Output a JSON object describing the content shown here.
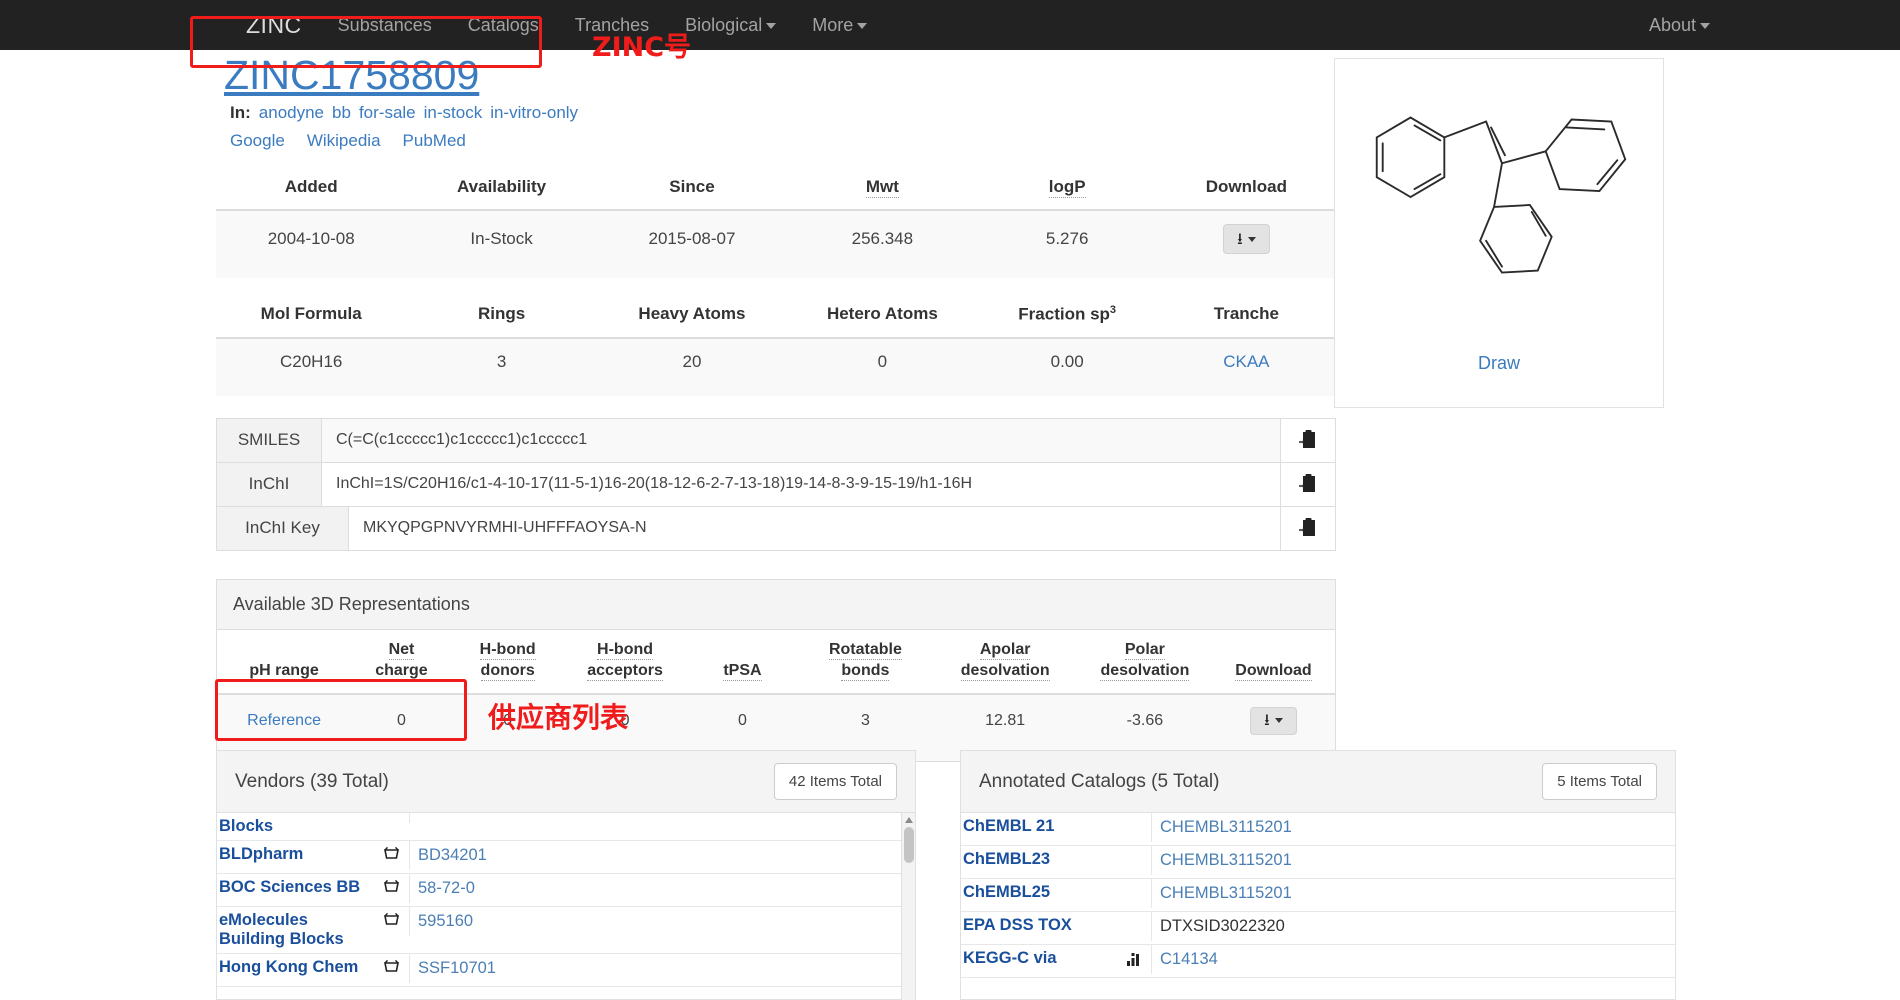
{
  "navbar": {
    "brand": "ZINC",
    "items": [
      {
        "label": "Substances",
        "caret": false
      },
      {
        "label": "Catalogs",
        "caret": false
      },
      {
        "label": "Tranches",
        "caret": false
      },
      {
        "label": "Biological",
        "caret": true
      },
      {
        "label": "More",
        "caret": true
      }
    ],
    "right": {
      "label": "About",
      "caret": true
    }
  },
  "annotations": {
    "zinc_id_note": "ZINC号",
    "vendors_note": "供应商列表",
    "color": "#f01c1c"
  },
  "header": {
    "zinc_id": "ZINC1758809",
    "in_label": "In:",
    "in_tags": [
      "anodyne",
      "bb",
      "for-sale",
      "in-stock",
      "in-vitro-only"
    ],
    "external_links": [
      "Google",
      "Wikipedia",
      "PubMed"
    ]
  },
  "summary_table": {
    "headers": [
      "Added",
      "Availability",
      "Since",
      "Mwt",
      "logP",
      "Download"
    ],
    "dotted_headers": [
      "Mwt",
      "logP"
    ],
    "row": {
      "added": "2004-10-08",
      "availability": "In-Stock",
      "since": "2015-08-07",
      "mwt": "256.348",
      "logp": "5.276",
      "download_icon": "download-icon"
    }
  },
  "formula_table": {
    "headers": [
      "Mol Formula",
      "Rings",
      "Heavy Atoms",
      "Hetero Atoms",
      "Fraction sp",
      "Tranche"
    ],
    "fraction_sup": "3",
    "row": {
      "mol_formula": "C20H16",
      "rings": "3",
      "heavy_atoms": "20",
      "hetero_atoms": "0",
      "fraction_sp3": "0.00",
      "tranche": "CKAA"
    }
  },
  "identifiers": [
    {
      "label": "SMILES",
      "value": "C(=C(c1ccccc1)c1ccccc1)c1ccccc1",
      "copy_icon": "clipboard-icon"
    },
    {
      "label": "InChI",
      "value": "InChI=1S/C20H16/c1-4-10-17(11-5-1)16-20(18-12-6-2-7-13-18)19-14-8-3-9-15-19/h1-16H",
      "copy_icon": "clipboard-icon"
    },
    {
      "label": "InChI Key",
      "value": "MKYQPGPNVYRMHI-UHFFFAOYSA-N",
      "copy_icon": "clipboard-icon"
    }
  ],
  "representations_3d": {
    "title": "Available 3D Representations",
    "headers": [
      {
        "line1": "pH range",
        "line2": ""
      },
      {
        "line1": "Net",
        "line2": "charge"
      },
      {
        "line1": "H-bond",
        "line2": "donors"
      },
      {
        "line1": "H-bond",
        "line2": "acceptors"
      },
      {
        "line1": "tPSA",
        "line2": ""
      },
      {
        "line1": "Rotatable",
        "line2": "bonds"
      },
      {
        "line1": "Apolar",
        "line2": "desolvation"
      },
      {
        "line1": "Polar",
        "line2": "desolvation"
      },
      {
        "line1": "Download",
        "line2": ""
      }
    ],
    "row": {
      "ph_range": "Reference",
      "net_charge": "0",
      "hbond_donors": "0",
      "hbond_acceptors": "0",
      "tpsa": "0",
      "rotatable_bonds": "3",
      "apolar_desolvation": "12.81",
      "polar_desolvation": "-3.66",
      "download_icon": "download-icon"
    }
  },
  "vendors_panel": {
    "title": "Vendors (39 Total)",
    "items_button": "42 Items Total",
    "rows": [
      {
        "name": "Blocks",
        "value": "",
        "icon": "",
        "partial_top": true
      },
      {
        "name": "BLDpharm",
        "value": "BD34201",
        "icon": "cart-icon"
      },
      {
        "name": "BOC Sciences BB",
        "value": "58-72-0",
        "icon": "cart-icon"
      },
      {
        "name": "eMolecules Building Blocks",
        "value": "595160",
        "icon": "cart-icon"
      },
      {
        "name": "Hong Kong Chem",
        "value": "SSF10701",
        "icon": "cart-icon"
      }
    ]
  },
  "catalogs_panel": {
    "title": "Annotated Catalogs (5 Total)",
    "items_button": "5 Items Total",
    "rows": [
      {
        "name": "ChEMBL 21",
        "value": "CHEMBL3115201",
        "icon": "",
        "plain": false
      },
      {
        "name": "ChEMBL23",
        "value": "CHEMBL3115201",
        "icon": "",
        "plain": false
      },
      {
        "name": "ChEMBL25",
        "value": "CHEMBL3115201",
        "icon": "",
        "plain": false
      },
      {
        "name": "EPA DSS TOX",
        "value": "DTXSID3022320",
        "icon": "",
        "plain": true
      },
      {
        "name": "KEGG-C via",
        "value": "C14134",
        "icon": "grid-icon",
        "plain": false
      }
    ]
  },
  "molecule_card": {
    "draw_label": "Draw",
    "structure_name": "triphenylethylene-structure"
  }
}
